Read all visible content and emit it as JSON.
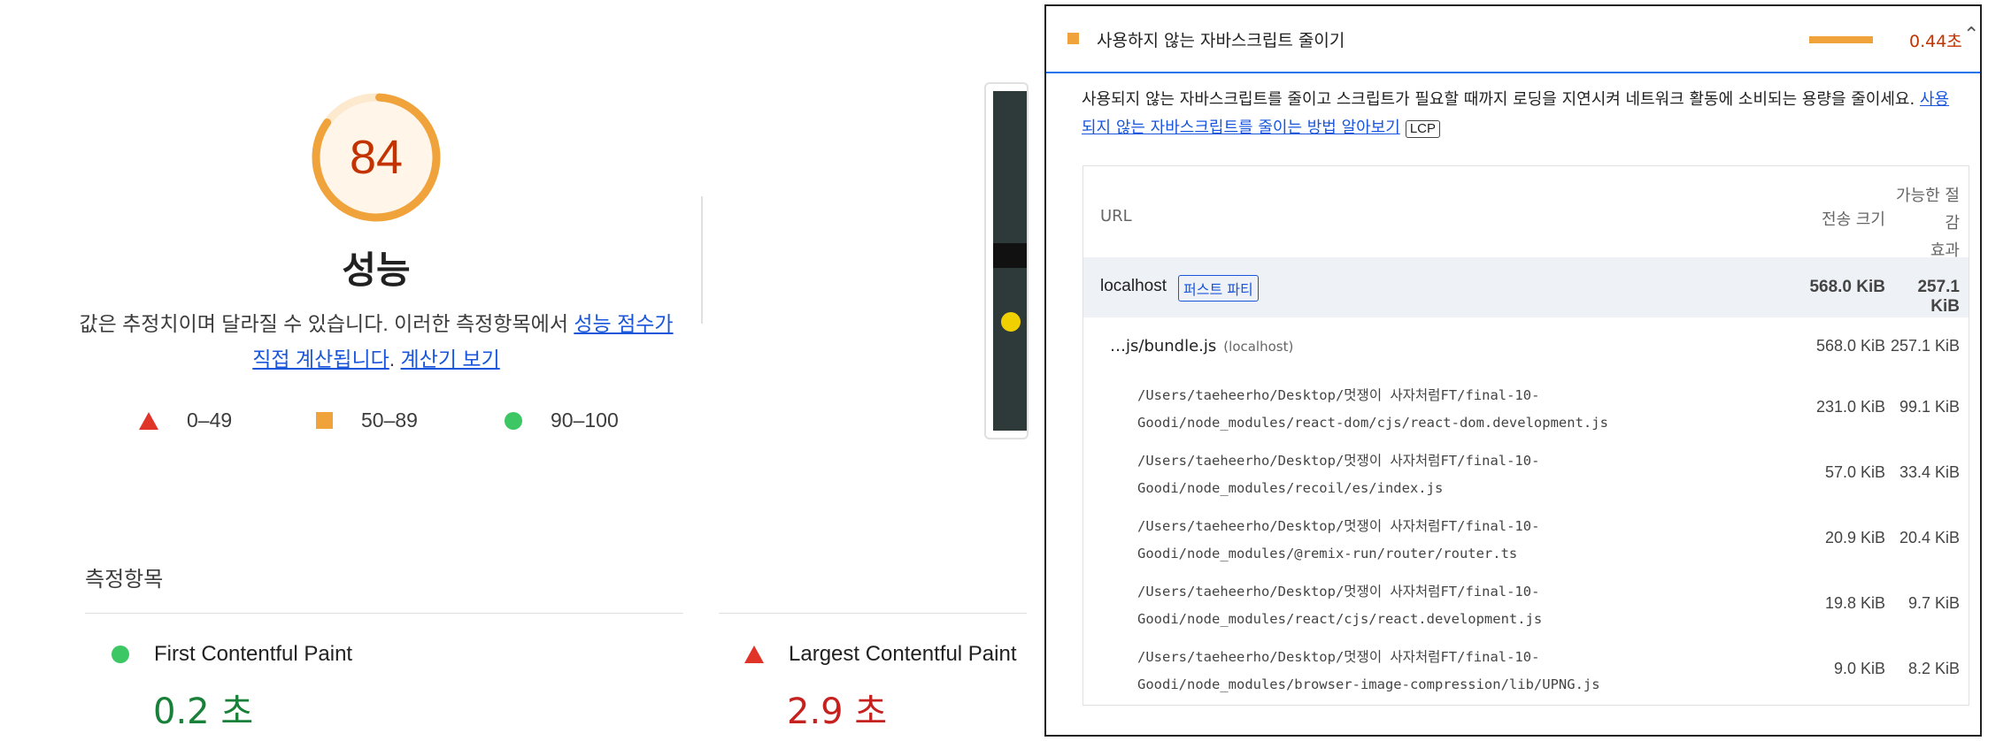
{
  "score": {
    "value": "84",
    "fraction": 0.84,
    "color": "#f0a33b"
  },
  "category_title": "성능",
  "description": {
    "text": "값은 추정치이며 달라질 수 있습니다. 이러한 측정항목에서 ",
    "link1": "성능 점수가 직접 계산됩니다",
    "sep": ". ",
    "link2": "계산기 보기"
  },
  "legend": [
    {
      "icon": "triangle-icon",
      "label": "0–49",
      "color": "#e03428"
    },
    {
      "icon": "square-icon",
      "label": "50–89",
      "color": "#f0a33b"
    },
    {
      "icon": "circle-icon",
      "label": "90–100",
      "color": "#3cc764"
    }
  ],
  "metrics_title": "측정항목",
  "metrics": [
    {
      "name": "First Contentful Paint",
      "value": "0.2 초",
      "icon": "circle-icon",
      "color": "#188038"
    },
    {
      "name": "Largest Contentful Paint",
      "value": "2.9 초",
      "icon": "triangle-icon",
      "color": "#c5221f"
    }
  ],
  "audit": {
    "title": "사용하지 않는 자바스크립트 줄이기",
    "savings": "0.44초",
    "description": "사용되지 않는 자바스크립트를 줄이고 스크립트가 필요할 때까지 로딩을 지연시켜 네트워크 활동에 소비되는 용량을 줄이세요. ",
    "link": "사용되지 않는 자바스크립트를 줄이는 방법 알아보기",
    "tag": "LCP",
    "table": {
      "headers": {
        "url": "URL",
        "size": "전송 크기",
        "savings_line1": "가능한 절감",
        "savings_line2": "효과"
      },
      "group": {
        "host": "localhost",
        "badge": "퍼스트 파티",
        "size": "568.0 KiB",
        "savings": "257.1 KiB"
      },
      "bundle": {
        "name": "…js/bundle.js",
        "host": "(localhost)",
        "size": "568.0 KiB",
        "savings": "257.1 KiB"
      },
      "rows": [
        {
          "line1": "/Users/taeheerho/Desktop/멋쟁이 사자처럼FT/final-10-",
          "line2": "Goodi/node_modules/react-dom/cjs/react-dom.development.js",
          "size": "231.0 KiB",
          "savings": "99.1 KiB"
        },
        {
          "line1": "/Users/taeheerho/Desktop/멋쟁이 사자처럼FT/final-10-",
          "line2": "Goodi/node_modules/recoil/es/index.js",
          "size": "57.0 KiB",
          "savings": "33.4 KiB"
        },
        {
          "line1": "/Users/taeheerho/Desktop/멋쟁이 사자처럼FT/final-10-",
          "line2": "Goodi/node_modules/@remix-run/router/router.ts",
          "size": "20.9 KiB",
          "savings": "20.4 KiB"
        },
        {
          "line1": "/Users/taeheerho/Desktop/멋쟁이 사자처럼FT/final-10-",
          "line2": "Goodi/node_modules/react/cjs/react.development.js",
          "size": "19.8 KiB",
          "savings": "9.7 KiB"
        },
        {
          "line1": "/Users/taeheerho/Desktop/멋쟁이 사자처럼FT/final-10-",
          "line2": "Goodi/node_modules/browser-image-compression/lib/UPNG.js",
          "size": "9.0 KiB",
          "savings": "8.2 KiB"
        }
      ]
    }
  }
}
